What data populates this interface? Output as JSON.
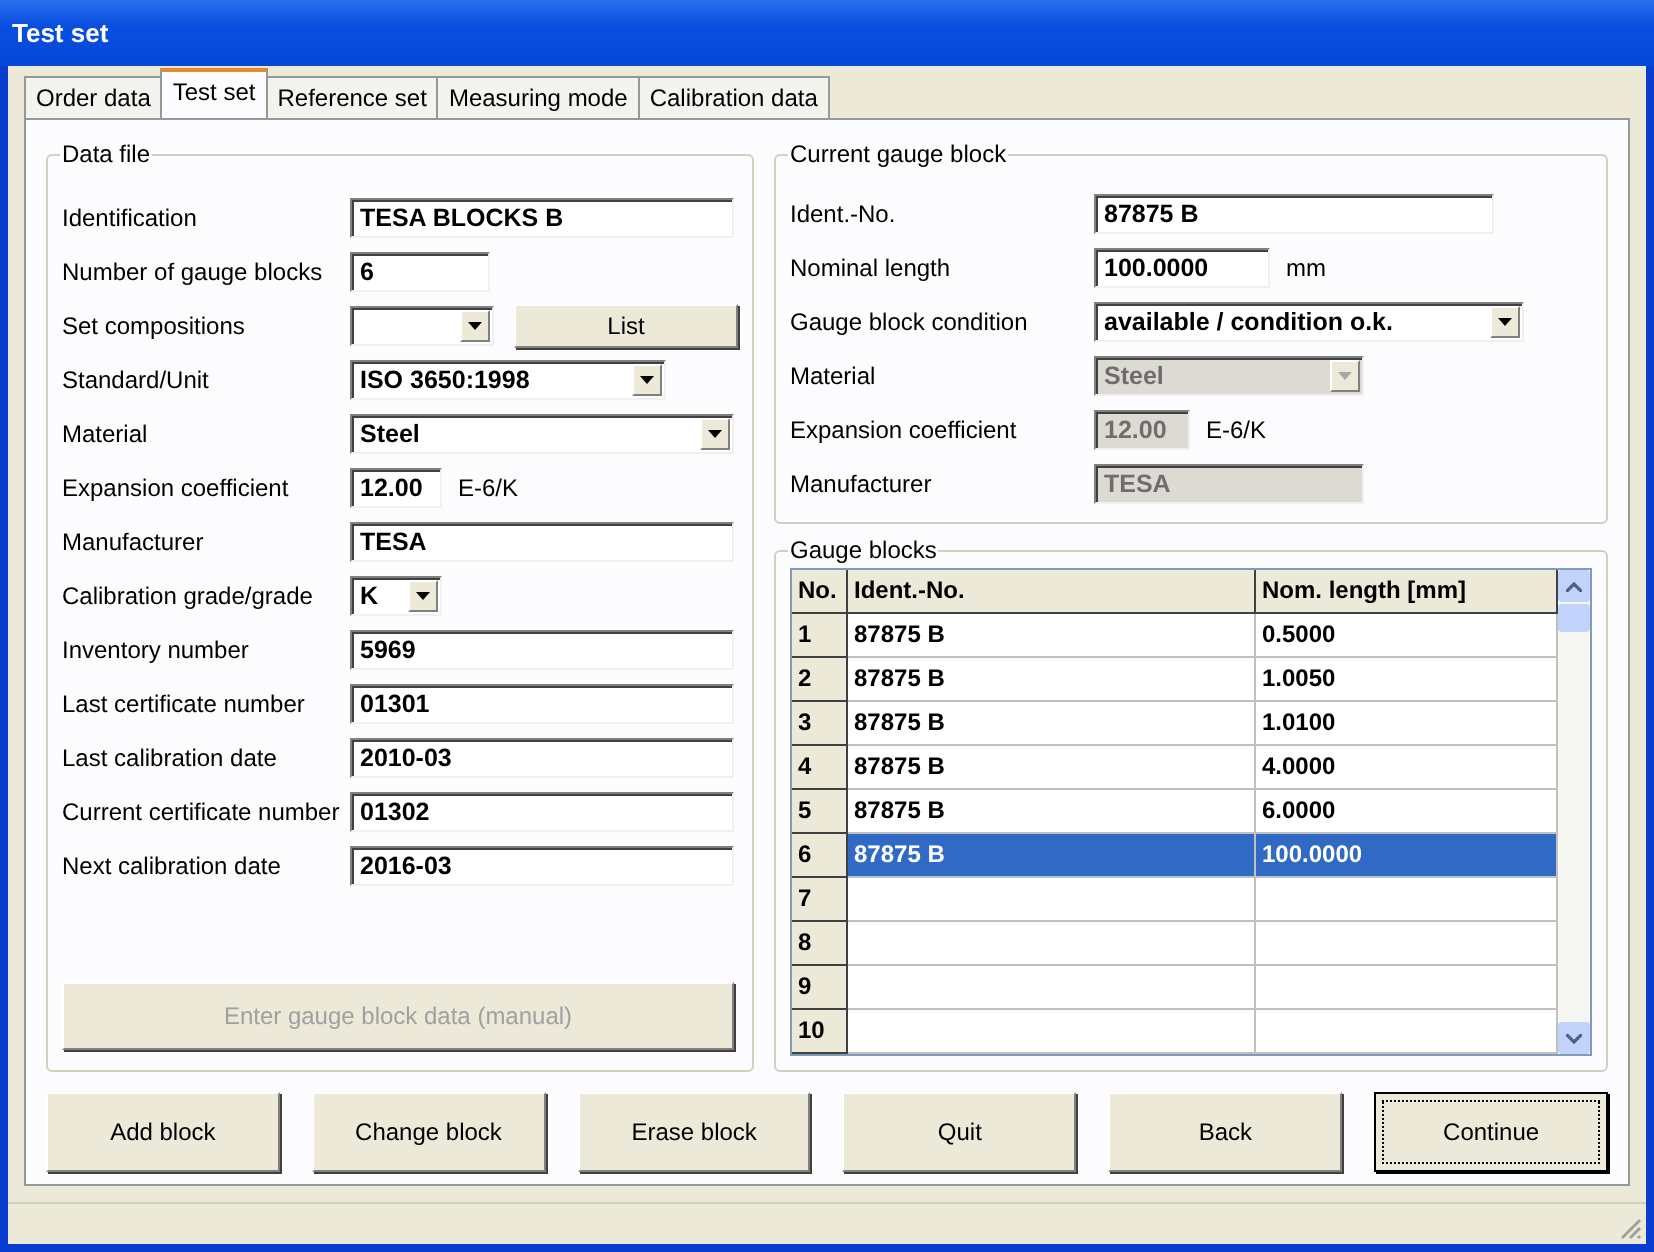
{
  "window": {
    "title": "Test set"
  },
  "tabs": [
    {
      "label": "Order data",
      "selected": false
    },
    {
      "label": "Test set",
      "selected": true
    },
    {
      "label": "Reference set",
      "selected": false
    },
    {
      "label": "Measuring mode",
      "selected": false
    },
    {
      "label": "Calibration data",
      "selected": false
    }
  ],
  "data_file": {
    "title": "Data file",
    "fields": [
      {
        "label": "Identification",
        "kind": "text",
        "value": "TESA BLOCKS B"
      },
      {
        "label": "Number of gauge blocks",
        "kind": "text",
        "value": "6"
      },
      {
        "label": "Set compositions",
        "kind": "combo_button",
        "button": "List"
      },
      {
        "label": "Standard/Unit",
        "kind": "combo",
        "value": "ISO 3650:1998"
      },
      {
        "label": "Material",
        "kind": "combo",
        "value": "Steel"
      },
      {
        "label": "Expansion coefficient",
        "kind": "text_unit",
        "value": "12.00",
        "unit": "E-6/K"
      },
      {
        "label": "Manufacturer",
        "kind": "text",
        "value": "TESA"
      },
      {
        "label": "Calibration grade/grade",
        "kind": "combo",
        "value": "K"
      },
      {
        "label": "Inventory number",
        "kind": "text",
        "value": "5969"
      },
      {
        "label": "Last certificate number",
        "kind": "text",
        "value": "01301"
      },
      {
        "label": "Last calibration date",
        "kind": "text",
        "value": "2010-03"
      },
      {
        "label": "Current certificate number",
        "kind": "text",
        "value": "01302"
      },
      {
        "label": "Next calibration date",
        "kind": "text",
        "value": "2016-03"
      }
    ],
    "button": {
      "label": "Enter gauge block data (manual)",
      "disabled": true
    }
  },
  "current_gauge_block": {
    "title": "Current gauge block",
    "fields": [
      {
        "label": "Ident.-No.",
        "kind": "text",
        "value": "87875 B",
        "disabled": false
      },
      {
        "label": "Nominal length",
        "kind": "text_unit",
        "value": "100.0000",
        "unit": "mm",
        "disabled": false
      },
      {
        "label": "Gauge block condition",
        "kind": "combo",
        "value": "available / condition o.k.",
        "disabled": false
      },
      {
        "label": "Material",
        "kind": "combo",
        "value": "Steel",
        "disabled": true
      },
      {
        "label": "Expansion coefficient",
        "kind": "text_unit",
        "value": "12.00",
        "unit": "E-6/K",
        "disabled": true
      },
      {
        "label": "Manufacturer",
        "kind": "text",
        "value": "TESA",
        "disabled": true
      }
    ]
  },
  "gauge_blocks": {
    "title": "Gauge blocks",
    "columns": [
      "No.",
      "Ident.-No.",
      "Nom. length [mm]"
    ],
    "rows": [
      {
        "no": "1",
        "ident": "87875 B",
        "length": "0.5000",
        "selected": false
      },
      {
        "no": "2",
        "ident": "87875 B",
        "length": "1.0050",
        "selected": false
      },
      {
        "no": "3",
        "ident": "87875 B",
        "length": "1.0100",
        "selected": false
      },
      {
        "no": "4",
        "ident": "87875 B",
        "length": "4.0000",
        "selected": false
      },
      {
        "no": "5",
        "ident": "87875 B",
        "length": "6.0000",
        "selected": false
      },
      {
        "no": "6",
        "ident": "87875 B",
        "length": "100.0000",
        "selected": true
      },
      {
        "no": "7",
        "selected": false
      },
      {
        "no": "8",
        "selected": false
      },
      {
        "no": "9",
        "selected": false
      },
      {
        "no": "10",
        "selected": false
      }
    ]
  },
  "buttons": [
    {
      "label": "Add block",
      "default": false
    },
    {
      "label": "Change block",
      "default": false
    },
    {
      "label": "Erase block",
      "default": false
    },
    {
      "label": "Quit",
      "default": false
    },
    {
      "label": "Back",
      "default": false
    },
    {
      "label": "Continue",
      "default": true
    }
  ]
}
